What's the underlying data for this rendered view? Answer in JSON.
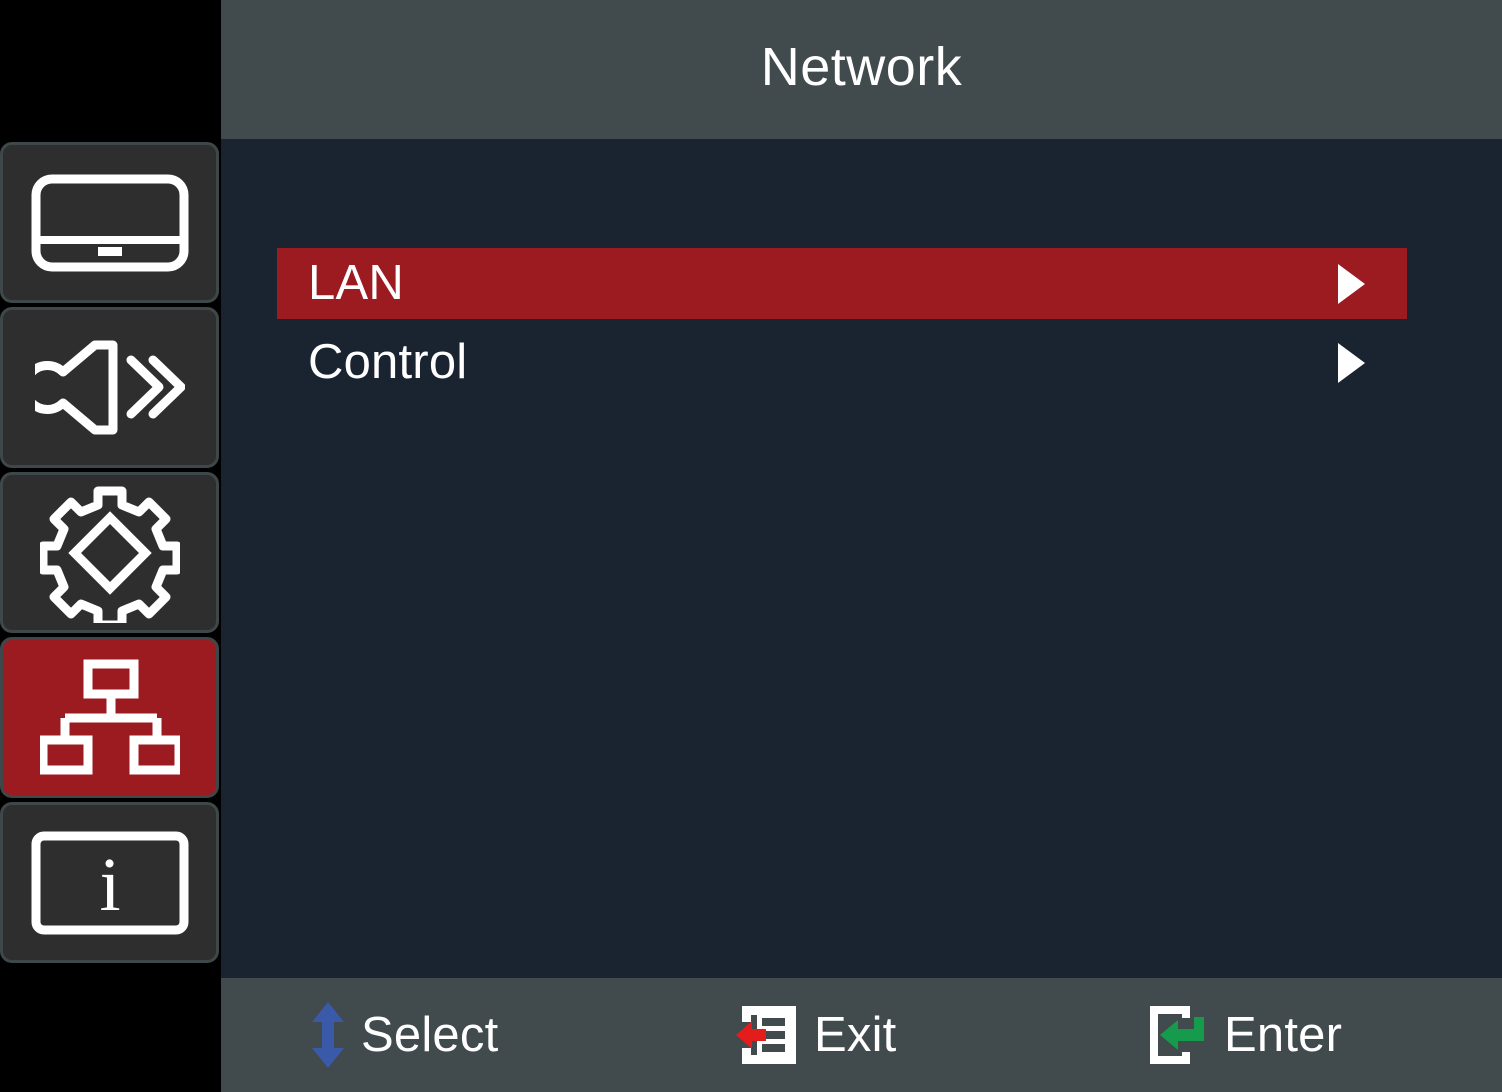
{
  "header": {
    "title": "Network",
    "background_color": "#414a4c",
    "text_color": "#ffffff"
  },
  "theme": {
    "accent_red": "#9c1b21",
    "content_background": "#1a2431",
    "sidebar_tile": "#2e2e2e",
    "sidebar_tile_border": "#3e484a",
    "select_arrow_blue": "#3a59a8",
    "exit_arrow_red": "#e31c1c",
    "enter_arrow_green": "#169b4c"
  },
  "sidebar": {
    "items": [
      {
        "icon": "display-icon",
        "name": "sidebar-item-display",
        "selected": false
      },
      {
        "icon": "audio-speaker-icon",
        "name": "sidebar-item-audio",
        "selected": false
      },
      {
        "icon": "gear-icon",
        "name": "sidebar-item-setup",
        "selected": false
      },
      {
        "icon": "network-hierarchy-icon",
        "name": "sidebar-item-network",
        "selected": true
      },
      {
        "icon": "information-icon",
        "name": "sidebar-item-information",
        "selected": false
      }
    ]
  },
  "menu": {
    "items": [
      {
        "label": "LAN",
        "submenu_indicator": "right-triangle",
        "highlighted": true
      },
      {
        "label": "Control",
        "submenu_indicator": "right-triangle",
        "highlighted": false
      }
    ]
  },
  "footer": {
    "hints": [
      {
        "icon": "up-down-arrow-icon",
        "label": "Select"
      },
      {
        "icon": "exit-menu-icon",
        "label": "Exit"
      },
      {
        "icon": "enter-return-icon",
        "label": "Enter"
      }
    ]
  }
}
